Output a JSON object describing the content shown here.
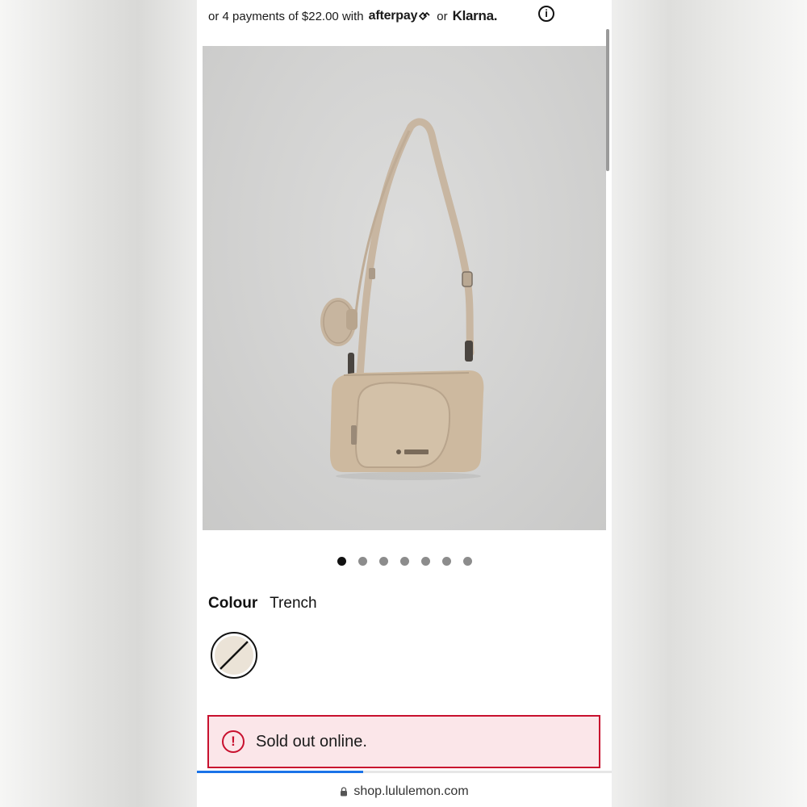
{
  "payment": {
    "prefix": "or 4 payments of $22.00 with",
    "afterpay": "afterpay",
    "or": "or",
    "klarna": "Klarna.",
    "info_icon": "info-icon"
  },
  "gallery": {
    "image_icon": "product-photo-bag",
    "logo_text": "lululemon",
    "dots": [
      {
        "active": true
      },
      {
        "active": false
      },
      {
        "active": false
      },
      {
        "active": false
      },
      {
        "active": false
      },
      {
        "active": false
      },
      {
        "active": false
      }
    ]
  },
  "colour": {
    "label": "Colour",
    "value": "Trench",
    "swatch_color": "#ebe3d7"
  },
  "notice": {
    "icon": "!",
    "text": "Sold out online."
  },
  "browser": {
    "url": "shop.lululemon.com",
    "load_progress": 0.4
  },
  "colors": {
    "alert_red": "#c8102e",
    "alert_bg": "#fbe6e9",
    "progress_blue": "#1a73e8"
  }
}
